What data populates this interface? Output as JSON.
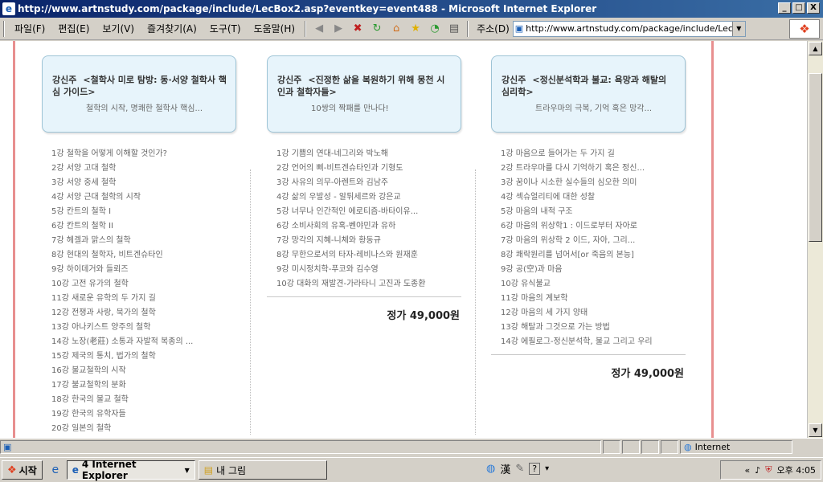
{
  "window": {
    "title": "http://www.artnstudy.com/package/include/LecBox2.asp?eventkey=event488 - Microsoft Internet Explorer",
    "min": "_",
    "max": "□",
    "close": "X"
  },
  "menu": {
    "items": [
      "파일(F)",
      "편집(E)",
      "보기(V)",
      "즐겨찾기(A)",
      "도구(T)",
      "도움말(H)"
    ],
    "address_label": "주소(D)",
    "address_value": "http://www.artnstudy.com/package/include/LecBox2"
  },
  "courses": [
    {
      "author": "강신주",
      "title": "<철학사 미로 탐방: 동·서양 철학사 핵심 가이드>",
      "subtitle": "철학의 시작, 명쾌한 철학사 핵심...",
      "lessons": [
        "1강 철학을 어떻게 이해할 것인가?",
        "2강 서양 고대 철학",
        "3강 서양 중세 철학",
        "4강 서양 근대 철학의 시작",
        "5강 칸트의 철학 I",
        "6강 칸트의 철학 II",
        "7강 헤겔과 맑스의 철학",
        "8강 현대의 철학자, 비트겐슈타인",
        "9강 하이데거와 들뢰즈",
        "10강 고전 유가의 철학",
        "11강 새로운 유학의 두 가지 길",
        "12강 전쟁과 사랑, 묵가의 철학",
        "13강 아나키스트 양주의 철학",
        "14강 노장(老莊) 소통과 자발적 복종의 ...",
        "15강 제국의 통치, 법가의 철학",
        "16강 불교철학의 시작",
        "17강 불교철학의 분화",
        "18강 한국의 불교 철학",
        "19강 한국의 유학자들",
        "20강 일본의 철학"
      ],
      "price": ""
    },
    {
      "author": "강신주",
      "title": "<진정한 삶을 복원하기 위해 몽천 시인과 철학자들>",
      "subtitle": "10쌍의 짝패를 만나다!",
      "lessons": [
        "1강 기쁨의 연대-네그리와 박노해",
        "2강 언어의 삐-비트겐슈타인과 기형도",
        "3강 사유의 의무-아렌트와 김남주",
        "4강 삶의 우발성 - 알튀세르와 강은교",
        "5강 너무나 인간적인 에로티즘-바타이유...",
        "6강 소비사회의 유혹-벤야민과 유하",
        "7강 망각의 지혜-니체와 황동규",
        "8강 무한으로서의 타자-레비나스와 원재훈",
        "9강 미시정치학-푸코와 김수영",
        "10강 대화의 재발견-가라타니 고진과 도종환"
      ],
      "price": "정가 49,000원"
    },
    {
      "author": "강신주",
      "title": "<정신분석학과 불교: 욕망과 해탈의 심리학>",
      "subtitle": "트라우마의 극복, 기억 혹은 망각...",
      "lessons": [
        "1강 마음으로 들어가는 두 가지 길",
        "2강 트라우마를 다시 기억하기 혹은 정신...",
        "3강 꿈이나 시소한 실수들의 심오한 의미",
        "4강 섹슈얼리티에 대한 성찰",
        "5강 마음의 내적 구조",
        "6강 마음의 위상학1 : 이드로부터 자아로",
        "7강 마음의 위상학 2 이드, 자아, 그리...",
        "8강 쾌락원리를 넘어서[or 죽음의 본능]",
        "9강 공(空)과 마음",
        "10강 유식불교",
        "11강 마음의 계보학",
        "12강 마음의 세 가지 양태",
        "13강 해탈과 그것으로 가는 방법",
        "14강 에필로그-정신분석학, 불교 그리고 우리"
      ],
      "price": "정가 49,000원"
    }
  ],
  "status": {
    "zone": "Internet"
  },
  "taskbar": {
    "start": "시작",
    "ie_group": "4 Internet Explorer",
    "paint": "내 그림",
    "ime": "漢",
    "clock": "오후 4:05"
  }
}
